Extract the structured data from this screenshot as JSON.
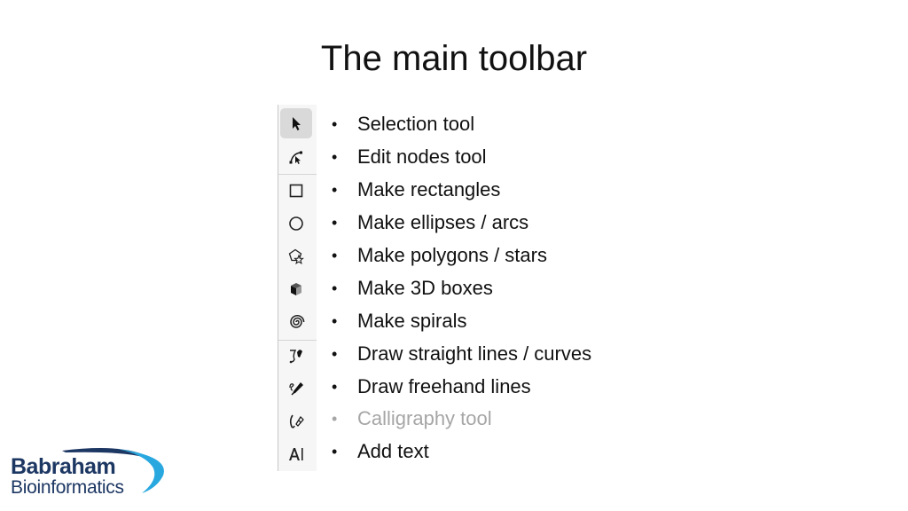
{
  "slide": {
    "title": "The main toolbar"
  },
  "toolbar": {
    "tools": [
      {
        "icon": "selection-arrow-icon",
        "active": true
      },
      {
        "icon": "edit-nodes-icon",
        "active": false
      },
      {
        "icon": "rectangle-icon",
        "active": false
      },
      {
        "icon": "ellipse-icon",
        "active": false
      },
      {
        "icon": "polygon-star-icon",
        "active": false
      },
      {
        "icon": "3d-box-icon",
        "active": false
      },
      {
        "icon": "spiral-icon",
        "active": false
      },
      {
        "icon": "bezier-pen-icon",
        "active": false
      },
      {
        "icon": "pencil-icon",
        "active": false
      },
      {
        "icon": "calligraphy-icon",
        "active": false
      },
      {
        "icon": "text-icon",
        "active": false,
        "glyph": "A|"
      }
    ]
  },
  "bullets": {
    "marker": "•",
    "items": [
      {
        "label": "Selection tool",
        "muted": false
      },
      {
        "label": "Edit nodes tool",
        "muted": false
      },
      {
        "label": "Make rectangles",
        "muted": false
      },
      {
        "label": "Make ellipses / arcs",
        "muted": false
      },
      {
        "label": "Make polygons / stars",
        "muted": false
      },
      {
        "label": "Make 3D boxes",
        "muted": false
      },
      {
        "label": "Make spirals",
        "muted": false
      },
      {
        "label": "Draw straight lines / curves",
        "muted": false
      },
      {
        "label": "Draw freehand lines",
        "muted": false
      },
      {
        "label": "Calligraphy tool",
        "muted": true
      },
      {
        "label": "Add text",
        "muted": false
      }
    ]
  },
  "logo": {
    "line1": "Babraham",
    "line2": "Bioinformatics",
    "colors": {
      "text": "#1d3763",
      "swoosh_dark": "#1d3763",
      "swoosh_light": "#29a8e0"
    }
  }
}
